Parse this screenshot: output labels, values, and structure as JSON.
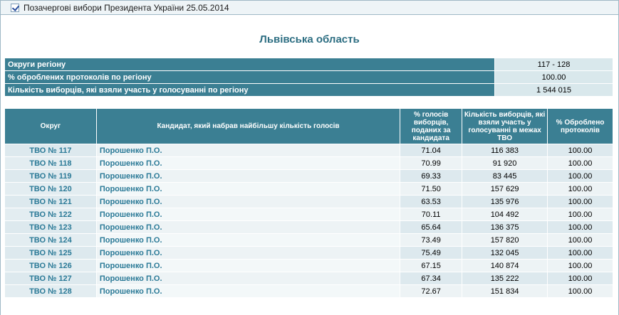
{
  "header": {
    "checked": true,
    "title": "Позачергові вибори Президента України 25.05.2014"
  },
  "region": {
    "title": "Львівська область"
  },
  "summary": [
    {
      "label": "Округи регіону",
      "value": "117 - 128"
    },
    {
      "label": "% оброблених протоколів по регіону",
      "value": "100.00"
    },
    {
      "label": "Кількість виборців, які взяли участь у голосуванні по регіону",
      "value": "1 544 015"
    }
  ],
  "table": {
    "columns": [
      "Округ",
      "Кандидат, який набрав найбільшу кількість голосів",
      "% голосів виборців, поданих за кандидата",
      "Кількість виборців, які взяли участь у голосуванні в межах ТВО",
      "% Оброблено протоколів"
    ],
    "rows": [
      {
        "okrug": "ТВО № 117",
        "candidate": "Порошенко П.О.",
        "pct": "71.04",
        "voters": "116 383",
        "processed": "100.00"
      },
      {
        "okrug": "ТВО № 118",
        "candidate": "Порошенко П.О.",
        "pct": "70.99",
        "voters": "91 920",
        "processed": "100.00"
      },
      {
        "okrug": "ТВО № 119",
        "candidate": "Порошенко П.О.",
        "pct": "69.33",
        "voters": "83 445",
        "processed": "100.00"
      },
      {
        "okrug": "ТВО № 120",
        "candidate": "Порошенко П.О.",
        "pct": "71.50",
        "voters": "157 629",
        "processed": "100.00"
      },
      {
        "okrug": "ТВО № 121",
        "candidate": "Порошенко П.О.",
        "pct": "63.53",
        "voters": "135 976",
        "processed": "100.00"
      },
      {
        "okrug": "ТВО № 122",
        "candidate": "Порошенко П.О.",
        "pct": "70.11",
        "voters": "104 492",
        "processed": "100.00"
      },
      {
        "okrug": "ТВО № 123",
        "candidate": "Порошенко П.О.",
        "pct": "65.64",
        "voters": "136 375",
        "processed": "100.00"
      },
      {
        "okrug": "ТВО № 124",
        "candidate": "Порошенко П.О.",
        "pct": "73.49",
        "voters": "157 820",
        "processed": "100.00"
      },
      {
        "okrug": "ТВО № 125",
        "candidate": "Порошенко П.О.",
        "pct": "75.49",
        "voters": "132 045",
        "processed": "100.00"
      },
      {
        "okrug": "ТВО № 126",
        "candidate": "Порошенко П.О.",
        "pct": "67.15",
        "voters": "140 874",
        "processed": "100.00"
      },
      {
        "okrug": "ТВО № 127",
        "candidate": "Порошенко П.О.",
        "pct": "67.34",
        "voters": "135 222",
        "processed": "100.00"
      },
      {
        "okrug": "ТВО № 128",
        "candidate": "Порошенко П.О.",
        "pct": "72.67",
        "voters": "151 834",
        "processed": "100.00"
      }
    ]
  },
  "colors": {
    "header_bg": "#3b7f93",
    "link": "#2b7a97",
    "row_light": "#edf3f5",
    "row_dark": "#dde9ee"
  }
}
